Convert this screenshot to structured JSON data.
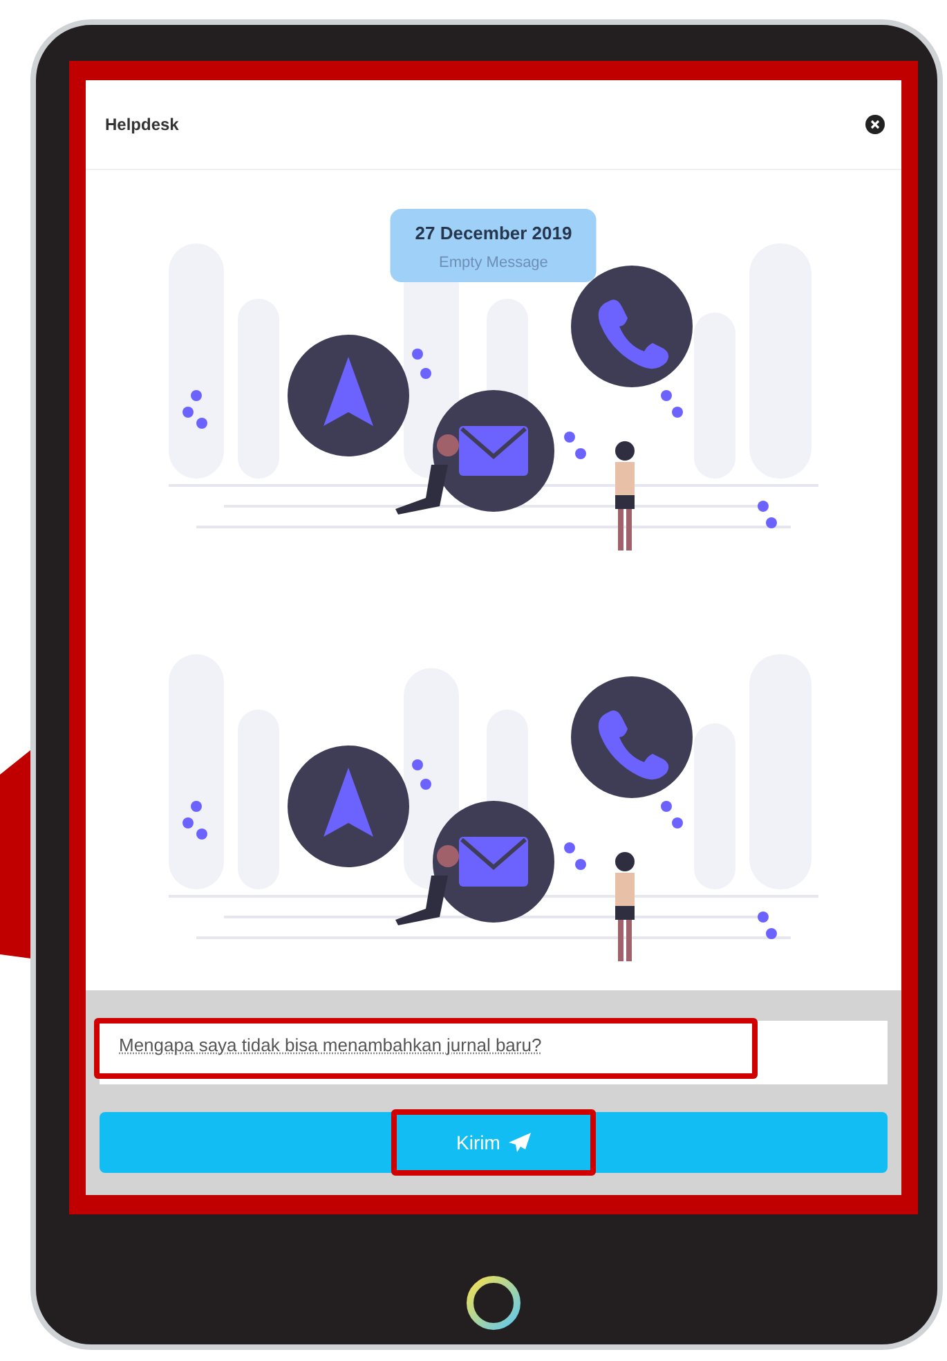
{
  "window": {
    "title": "Helpdesk"
  },
  "chat_bubble": {
    "date": "27 December 2019",
    "text": "Empty Message"
  },
  "message_field": {
    "value": "Mengapa saya tidak bisa menambahkan jurnal baru?",
    "highlighted": true
  },
  "send_button": {
    "label": "Kirim",
    "highlighted": true
  }
}
